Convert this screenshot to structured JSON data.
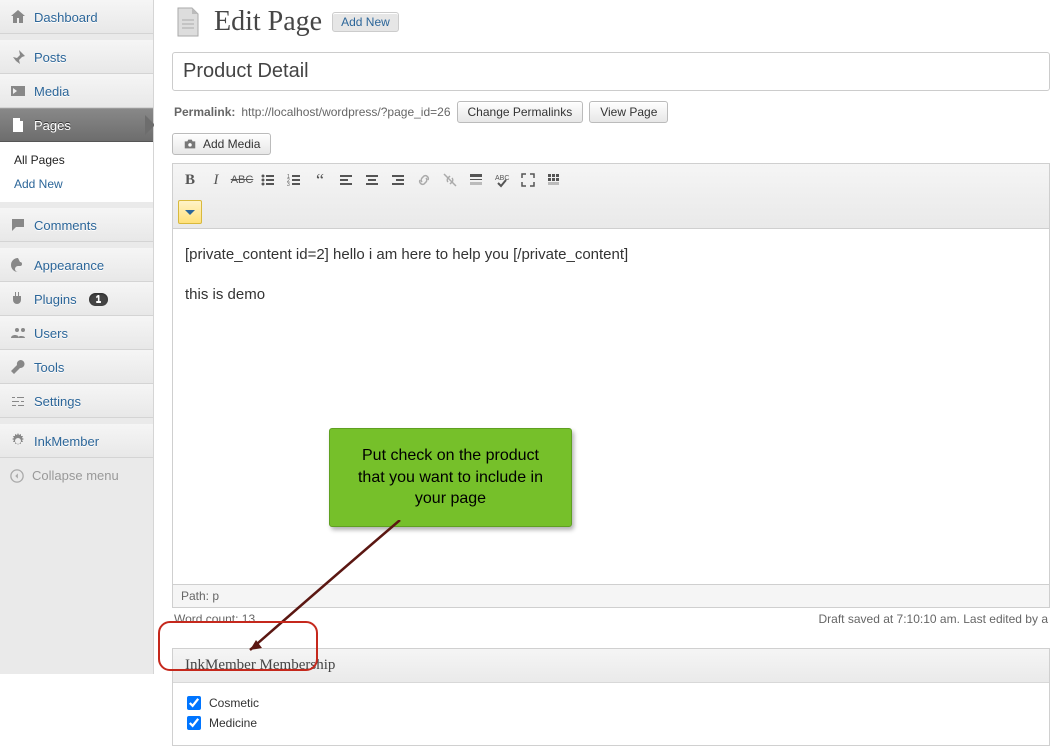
{
  "sidebar": {
    "items": [
      {
        "label": "Dashboard"
      },
      {
        "label": "Posts"
      },
      {
        "label": "Media"
      },
      {
        "label": "Pages"
      },
      {
        "label": "Comments"
      },
      {
        "label": "Appearance"
      },
      {
        "label": "Plugins",
        "badge": "1"
      },
      {
        "label": "Users"
      },
      {
        "label": "Tools"
      },
      {
        "label": "Settings"
      },
      {
        "label": "InkMember"
      }
    ],
    "sub_pages": {
      "all": "All Pages",
      "addnew": "Add New"
    },
    "collapse": "Collapse menu"
  },
  "header": {
    "title": "Edit Page",
    "add_new": "Add New"
  },
  "title_input": {
    "value": "Product Detail"
  },
  "permalink": {
    "label": "Permalink:",
    "url": "http://localhost/wordpress/?page_id=26",
    "change_btn": "Change Permalinks",
    "view_btn": "View Page"
  },
  "media": {
    "add_media": "Add Media"
  },
  "editor": {
    "line1": "[private_content id=2] hello i am here to help you  [/private_content]",
    "line2": "this is demo",
    "path_label": "Path: p",
    "word_count": "Word count: 13",
    "autosave": "Draft saved at 7:10:10 am. Last edited by a"
  },
  "metabox": {
    "title": "InkMember Membership",
    "checks": [
      {
        "label": "Cosmetic",
        "checked": true
      },
      {
        "label": "Medicine",
        "checked": true
      }
    ]
  },
  "annotation": {
    "text": "Put check on the product that you want to include in your page"
  }
}
